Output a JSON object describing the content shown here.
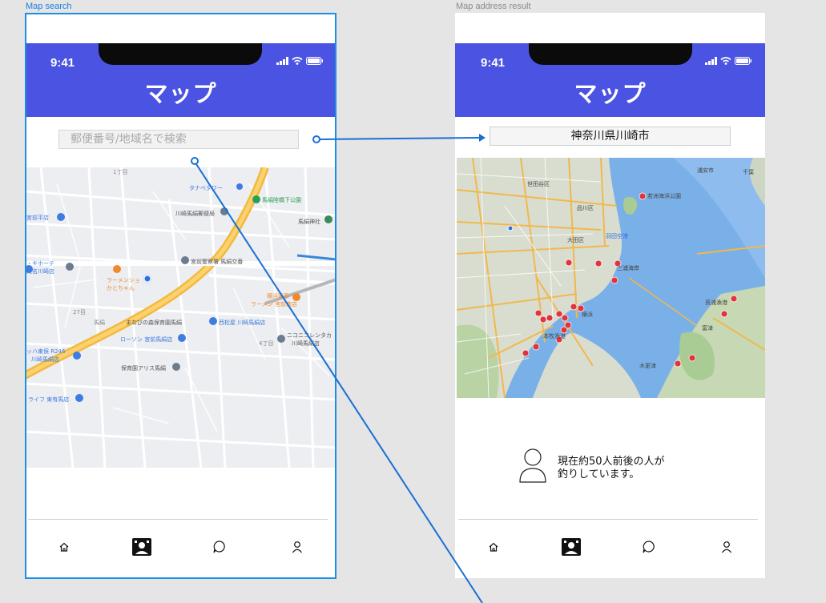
{
  "frames": {
    "search": {
      "label": "Map search"
    },
    "result": {
      "label": "Map address result"
    }
  },
  "status": {
    "time": "9:41"
  },
  "app": {
    "title": "マップ"
  },
  "search": {
    "placeholder": "郵便番号/地域名で検索"
  },
  "result": {
    "address": "神奈川県川崎市",
    "people_text": "現在約50人前後の人が釣りしています。"
  },
  "map1_labels": {
    "l1": "タナベタワー",
    "l2": "馬絹陸橋下公園",
    "l3": "川崎馬絹郵便局",
    "l4": "馬絹神社",
    "l5": "宮前平店",
    "l6": "・キホーテ",
    "l7": "東名川崎店",
    "l8": "宮前警察署 馬絹交番",
    "l9": "ラーメンショ",
    "l10": "かとちゃん",
    "l11": "横浜家系",
    "l12": "ラーメン 宮前商店",
    "l13": "まなびの森保育園馬絹",
    "l14": "西松屋 川崎馬絹店",
    "l15": "ローソン 宮前馬絹店",
    "l16": "ニコニコレンタカ",
    "l17": "川崎馬絹店",
    "l18": "ッハ東俣 R246",
    "l19": "川崎馬絹店",
    "l20": "保育園アリス馬絹",
    "l21": "ライフ 東有馬店",
    "l22": "27目",
    "l23": "1丁目",
    "l24": "4丁目",
    "l25": "馬絹"
  },
  "map2_labels": {
    "w1": "世田谷区",
    "w2": "品川区",
    "w3": "大田区",
    "w4": "羽田空港",
    "w5": "若洲海浜公園",
    "w6": "三浦海岸",
    "w7": "本牧漁港",
    "w8": "横浜",
    "w9": "長浦漁港",
    "w10": "富津",
    "w11": "木更津",
    "w12": "浦安市",
    "w13": "千葉"
  },
  "nav_icons": [
    "home-icon",
    "map-icon",
    "chat-icon",
    "profile-icon"
  ],
  "colors": {
    "header": "#4b54e2",
    "selection": "#1a8fe3",
    "connector": "#1a6fd4",
    "pin": "#e0353c"
  }
}
